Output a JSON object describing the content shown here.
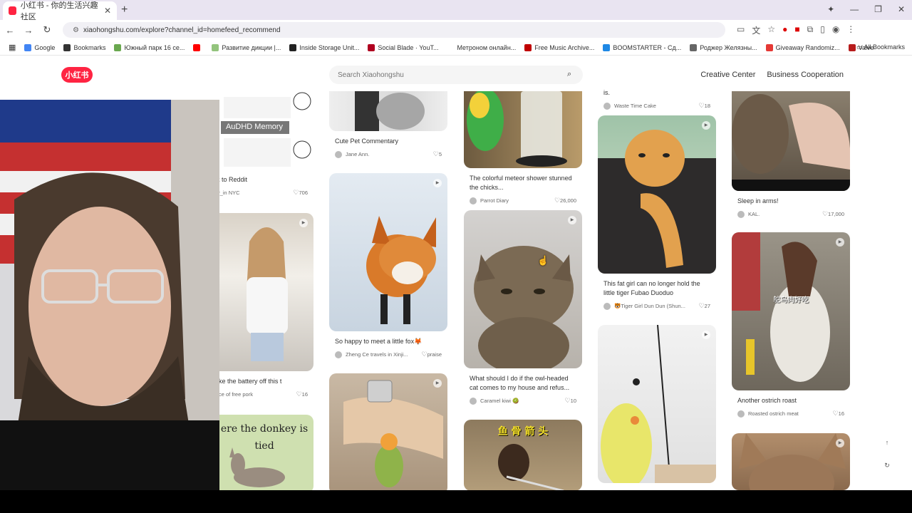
{
  "browser": {
    "tab_title": "小红书 - 你的生活兴趣社区",
    "url": "xiaohongshu.com/explore?channel_id=homefeed_recommend",
    "bookmarks": [
      {
        "label": "Google",
        "color": "#4285f4"
      },
      {
        "label": "Bookmarks",
        "color": "#333333"
      },
      {
        "label": "Южный парк 16 се...",
        "color": "#6aa84f"
      },
      {
        "label": "",
        "color": "#ff0000"
      },
      {
        "label": "Развитие дикции |...",
        "color": "#93c47d"
      },
      {
        "label": "Inside Storage Unit...",
        "color": "#222222"
      },
      {
        "label": "Social Blade · YouT...",
        "color": "#b00020"
      },
      {
        "label": "Метроном онлайн...",
        "color": "#ffffff"
      },
      {
        "label": "Free Music Archive...",
        "color": "#c00000"
      },
      {
        "label": "BOOMSTARTER - Сд...",
        "color": "#1e88e5"
      },
      {
        "label": "Роджер Желязны...",
        "color": "#666666"
      },
      {
        "label": "Giveaway Randomiz...",
        "color": "#e53935"
      },
      {
        "label": "Valve",
        "color": "#b71c1c"
      }
    ],
    "all_bookmarks": "All Bookmarks"
  },
  "site": {
    "logo": "小红书",
    "search_placeholder": "Search Xiaohongshu",
    "nav": [
      "Creative Center",
      "Business Cooperation"
    ]
  },
  "feed": {
    "col0": [
      {
        "title": "o back to Reddit",
        "author": "psy_in NYC",
        "likes": "706",
        "overlay": "AuDHD Memory"
      },
      {
        "title": "one take the battery off this t",
        "author": "piece of free pork",
        "likes": "16"
      },
      {
        "title": "",
        "author": "",
        "likes": "",
        "overlay": "ere the donkey is tied"
      }
    ],
    "col1": [
      {
        "title": "Cute Pet Commentary",
        "author": "Jane Ann.",
        "likes": "5"
      },
      {
        "title": "So happy to meet a little fox🦊",
        "author": "Zheng Ce travels in Xinji...",
        "likes": "praise"
      },
      {
        "title": "",
        "author": "",
        "likes": ""
      }
    ],
    "col2": [
      {
        "title": "The colorful meteor shower stunned the chicks...",
        "author": "Parrot Diary",
        "likes": "26,000"
      },
      {
        "title": "What should I do if the owl-headed cat comes to my house and refus...",
        "author": "Caramel kiwi 🥝",
        "likes": "10"
      },
      {
        "title": "",
        "author": "",
        "likes": "",
        "overlay": "鱼 骨 箭 头"
      }
    ],
    "col3": [
      {
        "title": "is.",
        "author": "Waste Time Cake",
        "likes": "18"
      },
      {
        "title": "This fat girl can no longer hold the little tiger Fubao Duoduo",
        "author": "🐯Tiger Girl Dun Dun (Shun...",
        "likes": "27"
      },
      {
        "title": "",
        "author": "",
        "likes": ""
      }
    ],
    "col4": [
      {
        "title": "Sleep in arms!",
        "author": "KAL.",
        "likes": "17,000"
      },
      {
        "title": "Another ostrich roast",
        "author": "Roasted ostrich meat",
        "likes": "16",
        "overlay": "鸵鸟肉好吃"
      },
      {
        "title": "",
        "author": "",
        "likes": ""
      }
    ]
  }
}
